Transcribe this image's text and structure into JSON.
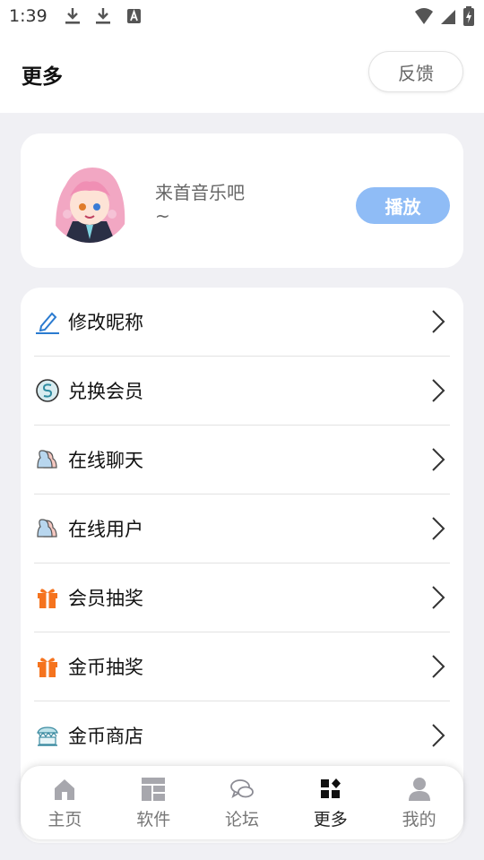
{
  "status_bar": {
    "time": "1:39",
    "icons": [
      "download-icon",
      "download-icon",
      "font-a-icon",
      "wifi-icon",
      "signal-icon",
      "battery-charging-icon"
    ]
  },
  "header": {
    "title": "更多",
    "feedback_label": "反馈"
  },
  "music": {
    "title": "来首音乐吧",
    "subtitle": "~",
    "play_label": "播放"
  },
  "menu": {
    "items": [
      {
        "label": "修改昵称",
        "icon": "pencil-icon"
      },
      {
        "label": "兑换会员",
        "icon": "coin-icon"
      },
      {
        "label": "在线聊天",
        "icon": "users-icon"
      },
      {
        "label": "在线用户",
        "icon": "users-icon"
      },
      {
        "label": "会员抽奖",
        "icon": "gift-icon"
      },
      {
        "label": "金币抽奖",
        "icon": "gift-icon"
      },
      {
        "label": "金币商店",
        "icon": "shop-icon"
      }
    ]
  },
  "bottom_nav": {
    "items": [
      {
        "label": "主页",
        "icon": "home-icon"
      },
      {
        "label": "软件",
        "icon": "apps-icon"
      },
      {
        "label": "论坛",
        "icon": "chat-icon"
      },
      {
        "label": "更多",
        "icon": "more-icon",
        "active": true
      },
      {
        "label": "我的",
        "icon": "user-icon"
      }
    ]
  },
  "colors": {
    "accent": "#8fbcf6",
    "background": "#f0f0f4",
    "gift": "#f5731e",
    "pencil": "#2b7bd0"
  }
}
